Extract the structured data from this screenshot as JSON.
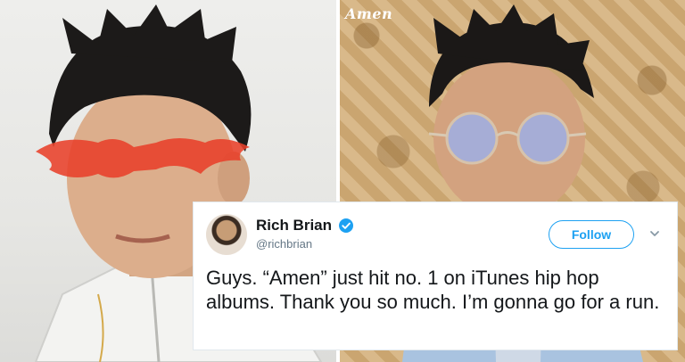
{
  "right_photo": {
    "logo_text": "Amen"
  },
  "tweet": {
    "display_name": "Rich Brian",
    "handle": "@richbrian",
    "follow_label": "Follow",
    "text": "Guys. “Amen” just hit no. 1 on iTunes hip hop albums. Thank you so much. I’m gonna go for a run.",
    "accent_color": "#1da1f2"
  },
  "icons": [
    "verified-badge-icon",
    "chevron-down-icon"
  ]
}
